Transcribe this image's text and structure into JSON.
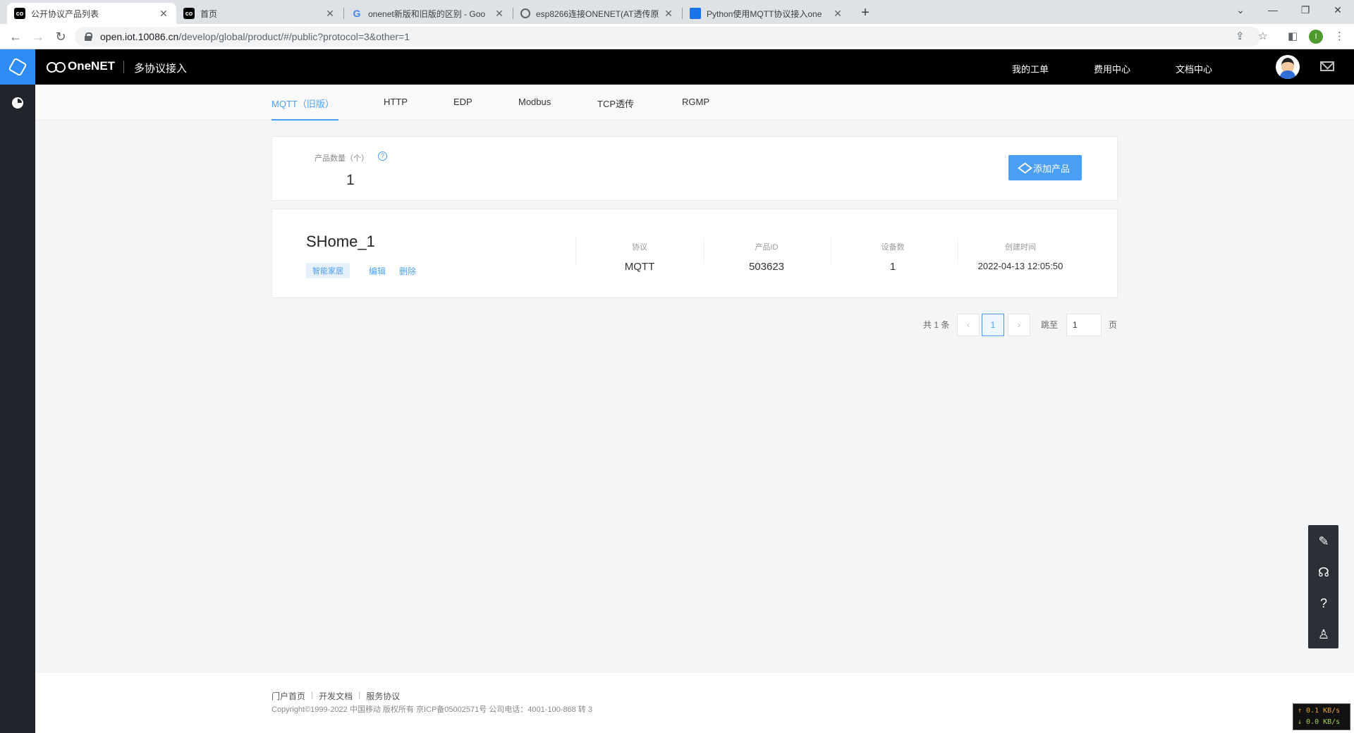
{
  "browser": {
    "tabs": [
      {
        "title": "公开协议产品列表",
        "favicon": "onenet-icon"
      },
      {
        "title": "首页",
        "favicon": "onenet-icon"
      },
      {
        "title": "onenet新版和旧版的区别 - Goo",
        "favicon": "google-icon"
      },
      {
        "title": "esp8266连接ONENET(AT透传原",
        "favicon": "globe-icon"
      },
      {
        "title": "Python使用MQTT协议接入one",
        "favicon": "blog-icon"
      }
    ],
    "url_host": "open.iot.10086.cn",
    "url_path": "/develop/global/product/#/public?protocol=3&other=1",
    "profile_initial": "I"
  },
  "app": {
    "brand": "OneNET",
    "subtitle": "多协议接入",
    "top_links": [
      "我的工单",
      "费用中心",
      "文档中心"
    ]
  },
  "protocol_tabs": [
    "MQTT（旧版）",
    "HTTP",
    "EDP",
    "Modbus",
    "TCP透传",
    "RGMP"
  ],
  "active_tab_index": 0,
  "summary": {
    "count_label": "产品数量（个）",
    "count_value": "1",
    "add_button": "添加产品"
  },
  "product": {
    "name": "SHome_1",
    "tag": "智能家居",
    "actions": [
      "编辑",
      "删除"
    ],
    "columns": [
      {
        "label": "协议",
        "value": "MQTT"
      },
      {
        "label": "产品ID",
        "value": "503623"
      },
      {
        "label": "设备数",
        "value": "1"
      },
      {
        "label": "创建时间",
        "value": "2022-04-13 12:05:50"
      }
    ]
  },
  "pagination": {
    "total": "共 1 条",
    "current_page": "1",
    "jump_label": "跳至",
    "jump_value": "1",
    "page_suffix": "页"
  },
  "footer": {
    "links": [
      "门户首页",
      "开发文档",
      "服务协议"
    ],
    "copyright": "Copyright©1999-2022 中国移动 版权所有 京ICP备05002571号 公司电话：4001-100-868 转 3"
  },
  "netmon": {
    "up": "↑ 0.1 KB/s",
    "down": "↓ 0.0 KB/s"
  },
  "colors": {
    "accent": "#4a9ff5",
    "topbar": "#000000",
    "sidebar": "#21252b"
  }
}
